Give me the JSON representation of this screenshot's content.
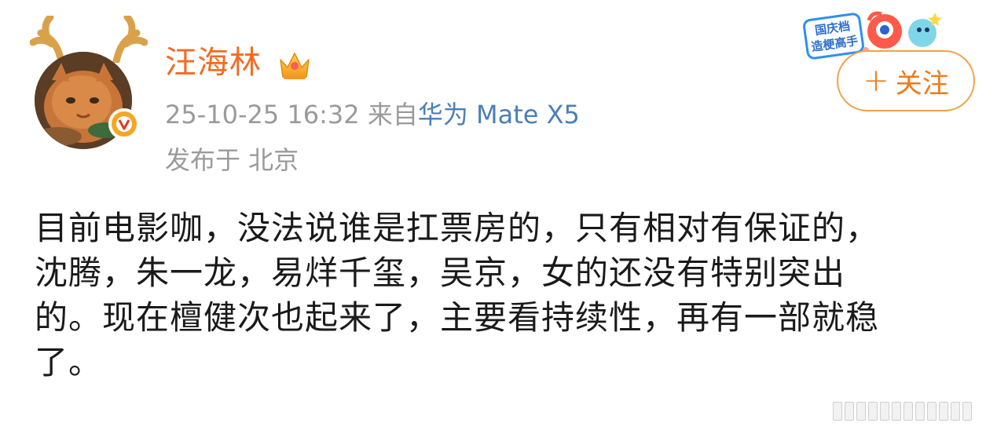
{
  "user": {
    "name": "汪海林",
    "verified": true
  },
  "meta": {
    "timestamp": "25-10-25 16:32",
    "source_prefix": "来自",
    "device": "华为 Mate X5",
    "location": "发布于 北京"
  },
  "promo": {
    "line1": "国庆档",
    "line2": "造梗高手"
  },
  "follow_button": {
    "plus": "+",
    "label": "关注"
  },
  "post": {
    "lines": [
      "目前电影咖，没法说谁是扛票房的，只有相对有保证的，",
      "沈腾，朱一龙，易烊千玺，吴京，女的还没有特别突出",
      "的。现在檀健次也起来了，主要看持续性，再有一部就稳",
      "了。"
    ]
  },
  "colors": {
    "username": "#f26b21",
    "device_link": "#4a7fb8",
    "meta_gray": "#9a9a9a",
    "follow_orange": "#f07a1a",
    "verified_badge": "#f5a623"
  },
  "icons": {
    "crown": "crown-icon",
    "verified": "verified-v-icon",
    "antlers": "antler-icon",
    "plus": "plus-icon"
  }
}
